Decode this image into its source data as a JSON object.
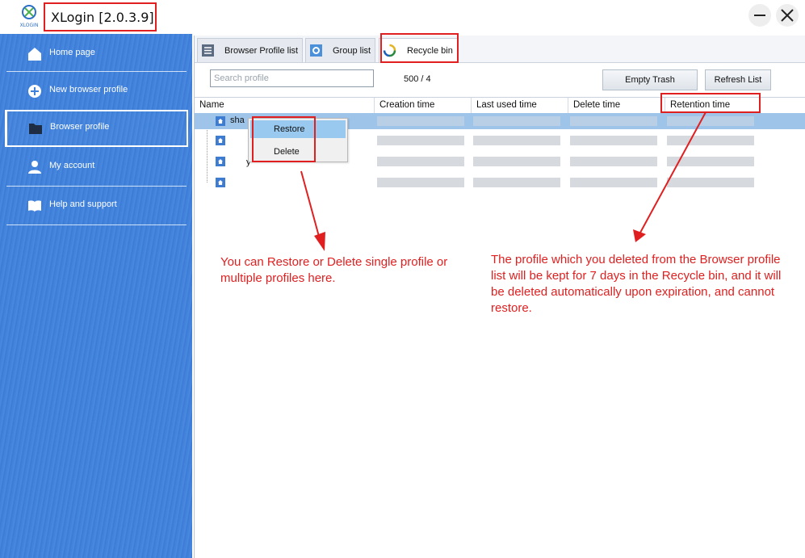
{
  "app": {
    "title": "XLogin [2.0.3.9]",
    "logo_text": "XLOGIN"
  },
  "window_controls": {
    "minimize_icon": "minimize-icon",
    "close_icon": "close-icon"
  },
  "sidebar": {
    "items": [
      {
        "label": "Home page",
        "icon": "home-icon"
      },
      {
        "label": "New browser profile",
        "icon": "plus-circle-icon"
      },
      {
        "label": "Browser profile",
        "icon": "folder-icon",
        "active": true
      },
      {
        "label": "My account",
        "icon": "user-icon"
      },
      {
        "label": "Help and support",
        "icon": "book-icon"
      }
    ]
  },
  "tabs": [
    {
      "label": "Browser Profile list",
      "icon": "list-icon"
    },
    {
      "label": "Group list",
      "icon": "gear-icon"
    },
    {
      "label": "Recycle bin",
      "icon": "recycle-icon",
      "active": true
    }
  ],
  "toolbar": {
    "search_placeholder": "Search profile",
    "count": "500 / 4",
    "empty_trash": "Empty Trash",
    "refresh_list": "Refresh List"
  },
  "table": {
    "columns": [
      "Name",
      "Creation time",
      "Last used time",
      "Delete time",
      "Retention time"
    ],
    "first_row_name": "sha",
    "third_row_name": "y"
  },
  "context_menu": {
    "items": [
      "Restore",
      "Delete"
    ]
  },
  "annotations": {
    "left": "You can Restore or Delete single profile or multiple profiles here.",
    "right": "The profile which you deleted from the Browser profile list will be kept for 7 days in the Recycle bin, and it will be deleted automatically upon expiration, and cannot restore."
  },
  "colors": {
    "accent": "#3f80da",
    "highlight": "#e02020",
    "selection": "#9ec4ea"
  }
}
